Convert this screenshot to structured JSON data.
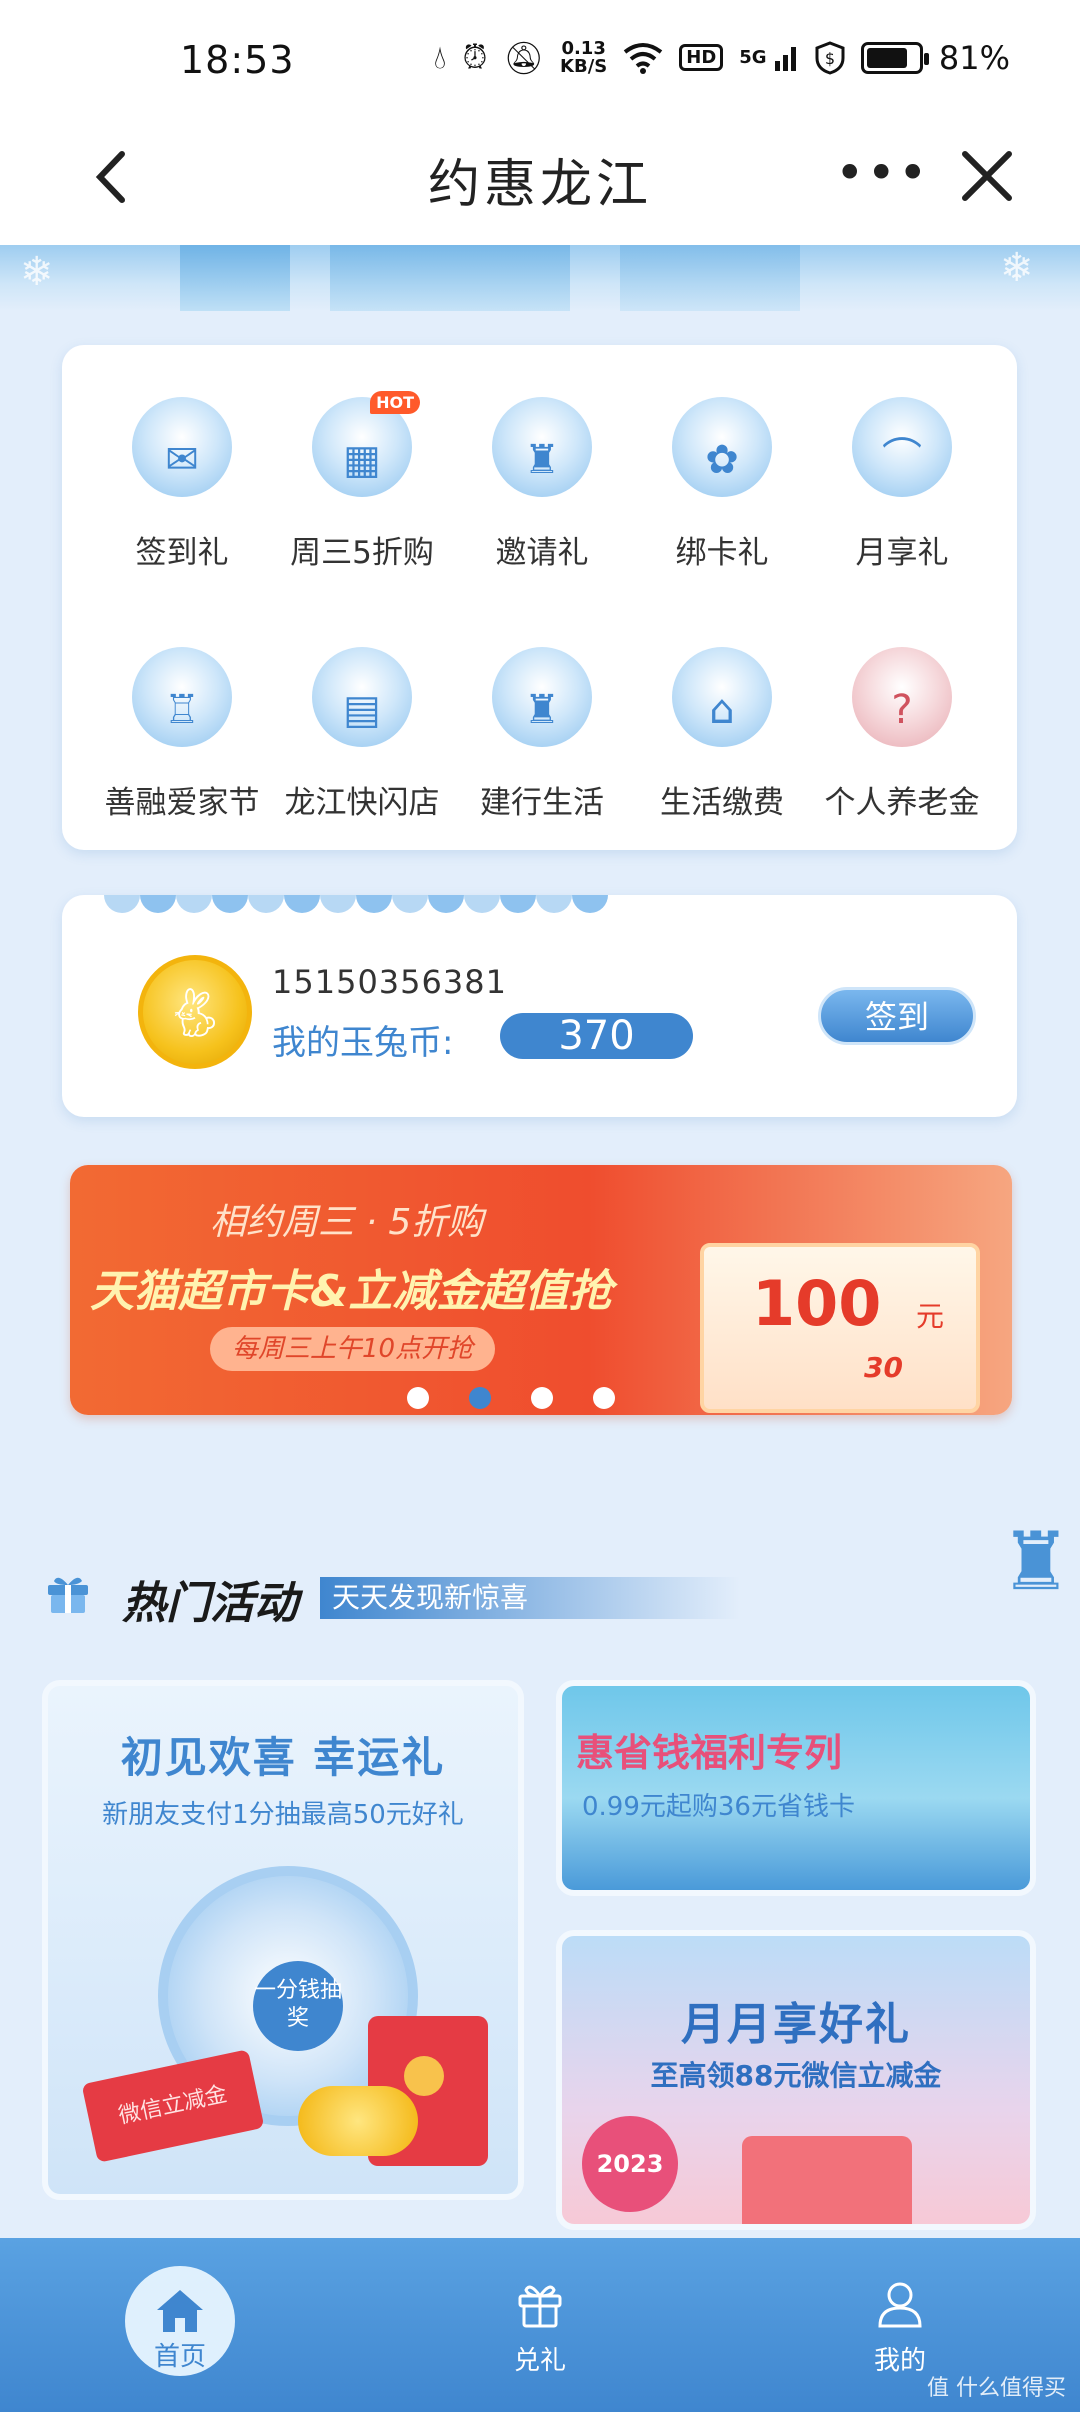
{
  "status_bar": {
    "time": "18:53",
    "net_speed_top": "0.13",
    "net_speed_bottom": "KB/S",
    "hd": "HD",
    "signal_label": "5G",
    "battery": "81%",
    "battery_level": 0.81
  },
  "nav": {
    "title": "约惠龙江",
    "more": "•••"
  },
  "grid": {
    "items": [
      {
        "label": "签到礼",
        "icon": "sign-in-gift-icon",
        "glyph": "✉"
      },
      {
        "label": "周三5折购",
        "icon": "wednesday-discount-icon",
        "glyph": "▦",
        "badge": "HOT"
      },
      {
        "label": "邀请礼",
        "icon": "invite-gift-icon",
        "glyph": "♜"
      },
      {
        "label": "绑卡礼",
        "icon": "bind-card-gift-icon",
        "glyph": "✿"
      },
      {
        "label": "月享礼",
        "icon": "monthly-gift-icon",
        "glyph": "⌒"
      },
      {
        "label": "善融爱家节",
        "icon": "home-festival-icon",
        "glyph": "♖"
      },
      {
        "label": "龙江快闪店",
        "icon": "popup-store-icon",
        "glyph": "▤"
      },
      {
        "label": "建行生活",
        "icon": "ccb-life-icon",
        "glyph": "♜"
      },
      {
        "label": "生活缴费",
        "icon": "bill-payment-icon",
        "glyph": "⌂"
      },
      {
        "label": "个人养老金",
        "icon": "pension-icon",
        "glyph": "?"
      }
    ]
  },
  "coin": {
    "phone": "15150356381",
    "label": "我的玉兔币:",
    "value": "370",
    "signin": "签到"
  },
  "promo": {
    "subtitle": "相约周三 · 5折购",
    "title": "天猫超市卡&立减金超值抢",
    "pill": "每周三上午10点开抢",
    "amount": "100",
    "unit": "元",
    "small": "30",
    "active_dot": 2,
    "dot_count": 4
  },
  "hot": {
    "title": "热门活动",
    "tagline": "天天发现新惊喜"
  },
  "tiles": {
    "left": {
      "title": "初见欢喜  幸运礼",
      "subtitle": "新朋友支付1分抽最高50元好礼",
      "wheel_center": "一分钱抽奖",
      "voucher": "微信立减金"
    },
    "right_top": {
      "title": "惠省钱福利专列",
      "subtitle": "0.99元起购36元省钱卡"
    },
    "right_bottom": {
      "title": "月月享好礼",
      "subtitle": "至高领88元微信立减金",
      "badge": "2023"
    }
  },
  "tabs": {
    "home": "首页",
    "redeem": "兑礼",
    "mine": "我的"
  },
  "watermark": "值 什么值得买",
  "colors": {
    "primary": "#3f86cf",
    "promo_orange": "#ef4d2e",
    "hot_badge": "#ff5a2a"
  }
}
